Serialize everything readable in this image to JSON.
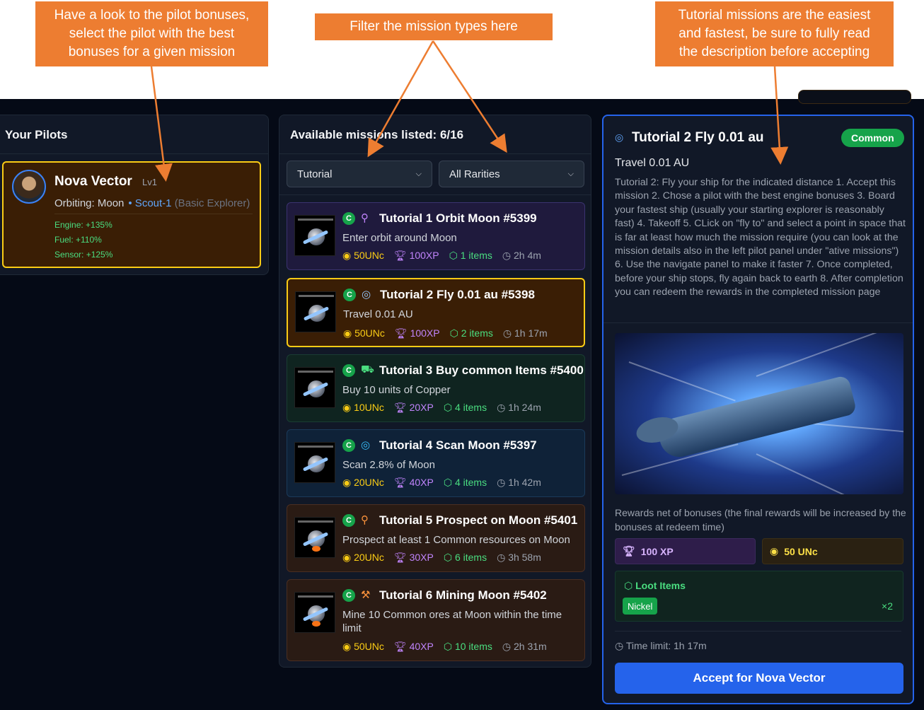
{
  "callouts": {
    "pilots": [
      "Have a look to the pilot bonuses,",
      "select the pilot with the best",
      "bonuses for a given mission"
    ],
    "filter": "Filter the mission types here",
    "tutorial": [
      "Tutorial missions are the easiest",
      "and fastest, be sure to fully read",
      "the description before accepting"
    ]
  },
  "pilots_panel": {
    "title": "Your Pilots",
    "pilot": {
      "name": "Nova Vector",
      "level": "Lv1",
      "orbiting": "Orbiting: Moon",
      "ship": "• Scout-1",
      "ship_class": "(Basic Explorer)",
      "bonuses": [
        "Engine: +135%",
        "Fuel: +110%",
        "Sensor: +125%"
      ]
    }
  },
  "missions_panel": {
    "title": "Available missions listed: 6/16",
    "type_filter": "Tutorial",
    "rarity_filter": "All Rarities",
    "missions": [
      {
        "badge": "C",
        "icon": "map-pin-icon",
        "glyph": "⚲",
        "title": "Tutorial 1 Orbit Moon #5399",
        "desc": "Enter orbit around Moon",
        "unc": "50UNc",
        "xp": "100XP",
        "items": "1 items",
        "time": "2h 4m",
        "theme": "purple"
      },
      {
        "badge": "C",
        "icon": "target-icon",
        "glyph": "◎",
        "title": "Tutorial 2 Fly 0.01 au #5398",
        "desc": "Travel 0.01 AU",
        "unc": "50UNc",
        "xp": "100XP",
        "items": "2 items",
        "time": "1h 17m",
        "theme": "selected"
      },
      {
        "badge": "C",
        "icon": "cart-icon",
        "glyph": "⛟",
        "title": "Tutorial 3 Buy common Items #5400",
        "desc": "Buy 10 units of Copper",
        "unc": "10UNc",
        "xp": "20XP",
        "items": "4 items",
        "time": "1h 24m",
        "theme": "green"
      },
      {
        "badge": "C",
        "icon": "radar-icon",
        "glyph": "◎",
        "title": "Tutorial 4 Scan Moon #5397",
        "desc": "Scan 2.8% of Moon",
        "unc": "20UNc",
        "xp": "40XP",
        "items": "4 items",
        "time": "1h 42m",
        "theme": "blue"
      },
      {
        "badge": "C",
        "icon": "search-icon",
        "glyph": "⚲",
        "title": "Tutorial 5 Prospect on Moon #5401",
        "desc": "Prospect at least 1 Common resources on Moon",
        "unc": "20UNc",
        "xp": "30XP",
        "items": "6 items",
        "time": "3h 58m",
        "theme": "brown"
      },
      {
        "badge": "C",
        "icon": "pickaxe-icon",
        "glyph": "⚒",
        "title": "Tutorial 6 Mining Moon #5402",
        "desc": "Mine 10 Common ores at Moon within the time limit",
        "unc": "50UNc",
        "xp": "40XP",
        "items": "10 items",
        "time": "2h 31m",
        "theme": "brown"
      }
    ]
  },
  "details_panel": {
    "title": "Tutorial 2 Fly 0.01 au",
    "rarity": "Common",
    "subtitle": "Travel 0.01 AU",
    "description": "Tutorial 2: Fly your ship for the indicated distance 1. Accept this mission 2. Chose a pilot with the best engine bonuses 3. Board your fastest ship (usually your starting explorer is reasonably fast) 4. Takeoff 5. CLick on \"fly to\" and select a point in space that is far at least how much the mission require (you can look at the mission details also in the left pilot panel under \"ative missions\") 6. Use the navigate panel to make it faster 7. Once completed, before your ship stops, fly again back to earth 8. After completion you can redeem the rewards in the completed mission page",
    "rewards_note": "Rewards net of bonuses (the final rewards will be increased by the bonuses at redeem time)",
    "xp_reward": "100 XP",
    "unc_reward": "50 UNc",
    "loot_title": "Loot Items",
    "loot_item": "Nickel",
    "loot_qty": "×2",
    "time_limit": "Time limit: 1h 17m",
    "accept_label": "Accept for Nova Vector"
  },
  "colors": {
    "callout": "#ed7d31",
    "app_background": "#050a16",
    "accent_blue": "#2563eb",
    "selected_border": "#facc15",
    "common_green": "#16a34a"
  }
}
